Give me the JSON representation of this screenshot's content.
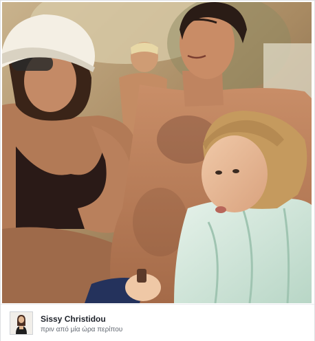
{
  "post": {
    "author_name": "Sissy Christidou",
    "timestamp": "πριν από μία ώρα περίπου"
  }
}
